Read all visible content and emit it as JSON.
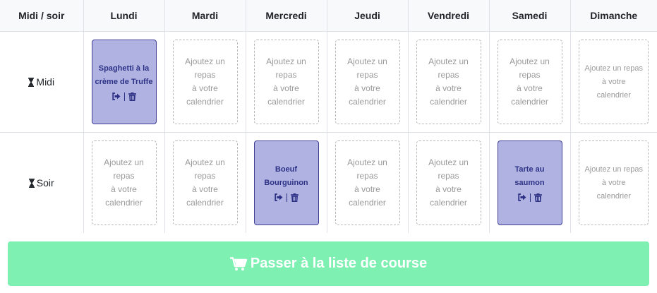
{
  "header": {
    "corner": "Midi / soir",
    "days": [
      "Lundi",
      "Mardi",
      "Mercredi",
      "Jeudi",
      "Vendredi",
      "Samedi",
      "Dimanche"
    ]
  },
  "slots": [
    {
      "label": "Midi",
      "icon": "hourglass-icon",
      "cells": [
        {
          "type": "meal",
          "name": "Spaghetti à la crème de Truffe"
        },
        {
          "type": "empty",
          "lines": [
            "Ajoutez un",
            "repas",
            "à votre",
            "calendrier"
          ]
        },
        {
          "type": "empty",
          "lines": [
            "Ajoutez un",
            "repas",
            "à votre",
            "calendrier"
          ]
        },
        {
          "type": "empty",
          "lines": [
            "Ajoutez un",
            "repas",
            "à votre",
            "calendrier"
          ]
        },
        {
          "type": "empty",
          "lines": [
            "Ajoutez un",
            "repas",
            "à votre",
            "calendrier"
          ]
        },
        {
          "type": "empty",
          "lines": [
            "Ajoutez un",
            "repas",
            "à votre",
            "calendrier"
          ]
        },
        {
          "type": "empty",
          "lines": [
            "Ajoutez un repas",
            "à votre",
            "calendrier"
          ]
        }
      ]
    },
    {
      "label": "Soir",
      "icon": "hourglass-icon",
      "cells": [
        {
          "type": "empty",
          "lines": [
            "Ajoutez un",
            "repas",
            "à votre",
            "calendrier"
          ]
        },
        {
          "type": "empty",
          "lines": [
            "Ajoutez un",
            "repas",
            "à votre",
            "calendrier"
          ]
        },
        {
          "type": "meal",
          "name": "Boeuf Bourguinon"
        },
        {
          "type": "empty",
          "lines": [
            "Ajoutez un",
            "repas",
            "à votre",
            "calendrier"
          ]
        },
        {
          "type": "empty",
          "lines": [
            "Ajoutez un",
            "repas",
            "à votre",
            "calendrier"
          ]
        },
        {
          "type": "meal",
          "name": "Tarte au saumon"
        },
        {
          "type": "empty",
          "lines": [
            "Ajoutez un repas",
            "à votre",
            "calendrier"
          ]
        }
      ]
    }
  ],
  "meal_actions": {
    "move_icon": "sign-out-icon",
    "delete_icon": "trash-icon"
  },
  "cta": {
    "label": "Passer à la liste de course",
    "icon": "shopping-cart-icon"
  },
  "colors": {
    "meal_bg": "#b0b3e2",
    "meal_border": "#3f3f96",
    "meal_text": "#2c3185",
    "cta_bg": "#7ef0b2"
  }
}
